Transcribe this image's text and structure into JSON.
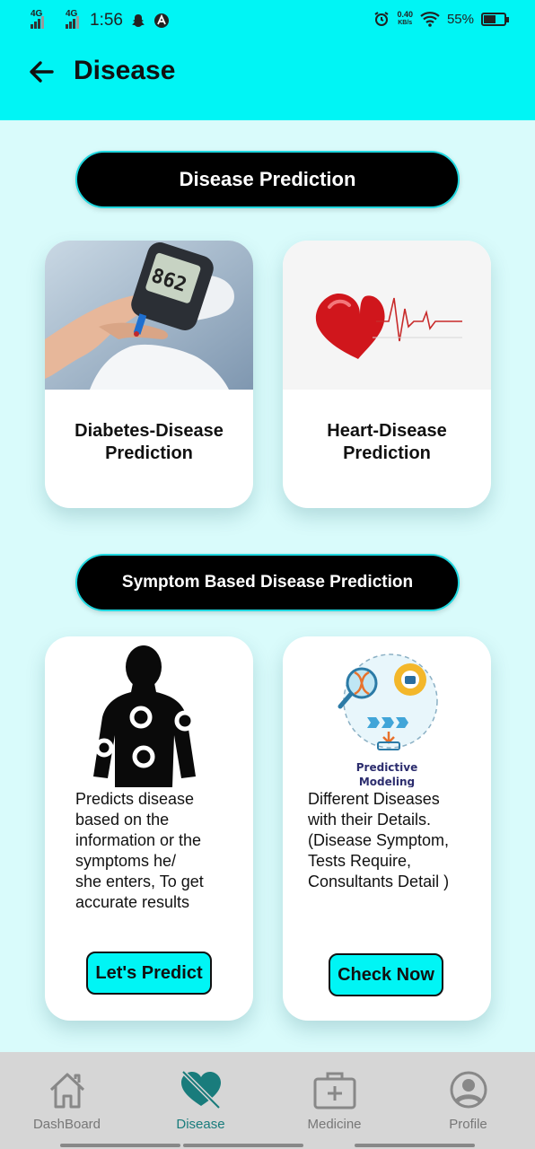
{
  "status_bar": {
    "sim1": "4G",
    "sim2": "4G",
    "time": "1:56",
    "net_speed_value": "0.40",
    "net_speed_unit": "KB/s",
    "battery": "55%"
  },
  "app_bar": {
    "title": "Disease",
    "back_icon": "arrow-left-icon"
  },
  "sections": {
    "disease_prediction": "Disease Prediction",
    "symptom_prediction": "Symptom Based Disease Prediction"
  },
  "cards": {
    "diabetes": {
      "title_line1": "Diabetes-Disease",
      "title_line2": "Prediction",
      "image_digits": "862"
    },
    "heart": {
      "title_line1": "Heart-Disease",
      "title_line2": "Prediction"
    },
    "symptom": {
      "lines": [
        "Predicts disease",
        "based on the",
        "information or the",
        "symptoms he/",
        "she enters, To get",
        "accurate results"
      ],
      "button": "Let's Predict"
    },
    "details": {
      "illus_label": "Predictive",
      "illus_label2": "Modeling",
      "lines": [
        "Different Diseases",
        "with their Details.",
        "(Disease Symptom,",
        "Tests Require,",
        "Consultants Detail )"
      ],
      "button": "Check Now"
    }
  },
  "bottom_nav": {
    "items": [
      {
        "label": "DashBoard",
        "icon": "home-icon"
      },
      {
        "label": "Disease",
        "icon": "heart-slash-icon",
        "active": true
      },
      {
        "label": "Medicine",
        "icon": "medical-kit-icon"
      },
      {
        "label": "Profile",
        "icon": "profile-icon"
      }
    ]
  },
  "colors": {
    "accent": "#00f5f5",
    "background": "#d9fbfb",
    "active_nav": "#197c7c"
  }
}
